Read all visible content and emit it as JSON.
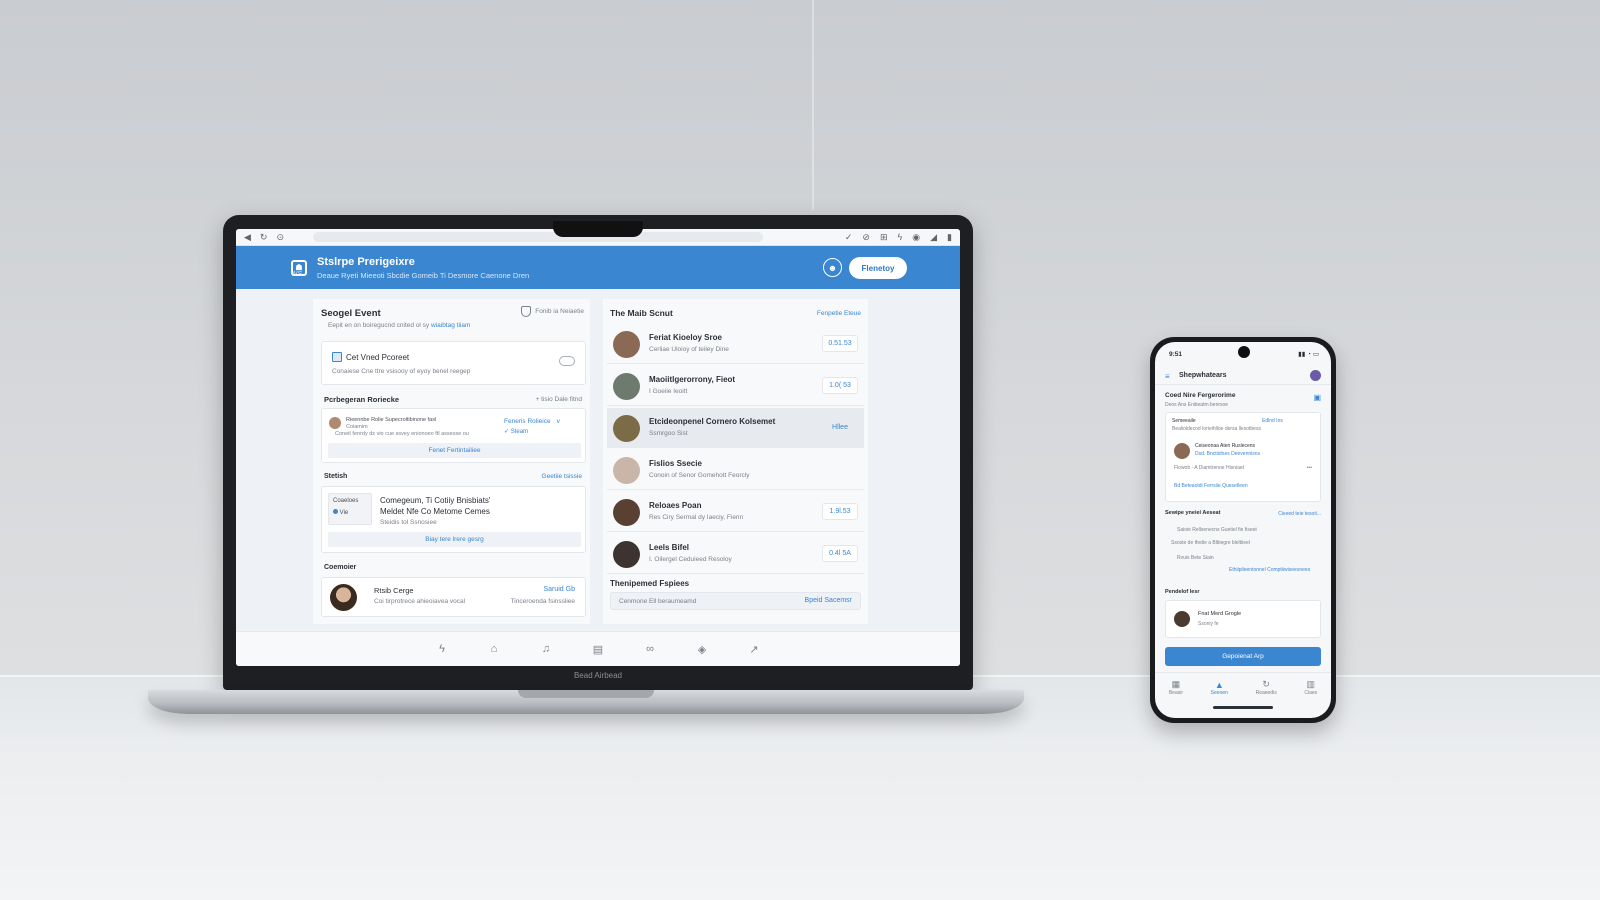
{
  "laptop": {
    "bezel_label": "Bead Airbead",
    "browser": {
      "icons": [
        "back-icon",
        "refresh-icon",
        "stop-icon",
        "bookmark-icon",
        "shield-icon",
        "tab-icon",
        "bolt-icon",
        "wifi-icon",
        "signal-icon",
        "battery-icon"
      ]
    },
    "header": {
      "logo_sub": "WS",
      "title": "Stslrpe Prerigeixre",
      "nav": "Deaue Ryeti   Mieeoti Sbcdie Gomeib Ti Desmore   Caenone Dren",
      "button": "Flenetoy"
    },
    "left": {
      "event_title": "Seogel Event",
      "event_action": "Fonib ia Neiaetie",
      "event_sub": "Eepit en on boiregucnd cnited ol sy",
      "event_sub_link": "wiaibtag tiiam",
      "main_card_title": "Cet Vned Pcoreet",
      "main_card_sub": "Conaiese Cne ttre vsisooy of eyoy benel reegep",
      "pref_label": "Pcrbegeran Roriecke",
      "pref_link": "+ tisio Dale fitnd",
      "pref_line1": "Rieennbe Rolie Supecroltibinone fasl",
      "pref_line2": "Coiamim",
      "pref_line3": "Coneit fenrdy ds vio cue ssvey enionoeo ftl assesse ou",
      "pref_opt1": "Feneris Rolieice",
      "pref_opt1_suffix": "v",
      "pref_opt2": "Steam",
      "pref_button": "Fenet Fertintailiee",
      "status_label": "Stetish",
      "status_link": "Geetiie tsissie",
      "status_thumb_title": "Coaeloes",
      "status_thumb_sub": "Vie",
      "status_text_1": "Comegeum, Ti Cotiiy Bnisbiats'",
      "status_text_2": "Meldet Nfe Co Metome Cemes",
      "status_sub": "Steidis tol Ssnosiee",
      "status_button": "Biay tere lrere gesrg",
      "contact_label": "Coemoier",
      "contact_name": "Rtsib Cerge",
      "contact_sub": "Coi tirprotrece ahieoiavea vocal",
      "contact_link": "Saruid Gb",
      "contact_link2": "Tinceroenda fsinssliee"
    },
    "right": {
      "title": "The Maib Scnut",
      "link": "Fenpetie Eteue",
      "people": [
        {
          "name": "Feriat Kioeloy Sroe",
          "sub": "Cerliae Uloioy of teiley Dine",
          "badge": "0.51.53",
          "plain": false,
          "highlight": false,
          "avatar": "#8a6a55"
        },
        {
          "name": "Maoiitlgerorrony, Fieot",
          "sub": "I Goeiie Ieoitt",
          "badge": "1.0( 53",
          "plain": false,
          "highlight": false,
          "avatar": "#6f7a6e"
        },
        {
          "name": "Etcideonpenel Cornero Kolsemet",
          "sub": "Ssmrgoo Sist",
          "badge": "Hllee",
          "plain": true,
          "highlight": true,
          "avatar": "#7b6b46"
        },
        {
          "name": "Fislios Ssecie",
          "sub": "Conoin of Senor Gomehott Feorcly",
          "badge": "",
          "plain": true,
          "highlight": false,
          "avatar": "#c9b6a8"
        },
        {
          "name": "Reloaes Poan",
          "sub": "Res Ciry Sermal dy Iaeciy, Fienn",
          "badge": "1.9l.53",
          "plain": false,
          "highlight": false,
          "avatar": "#5a4033"
        },
        {
          "name": "Leels Bifel",
          "sub": "I. Oilergel Ceduieed Resoloy",
          "badge": "0.4l 5A",
          "plain": false,
          "highlight": false,
          "avatar": "#3d3430"
        }
      ],
      "footer_title": "Thenipemed Fspiees",
      "input_placeholder": "Cenmone Ell beraumeamd",
      "input_action": "Bpeid Sacemsr"
    },
    "bottom_nav": [
      "bolt-icon",
      "home-icon",
      "bell-icon",
      "document-icon",
      "glasses-icon",
      "shield-icon",
      "share-icon"
    ]
  },
  "phone": {
    "time": "9:51",
    "status_icons": "▮▮ ◔ ▭",
    "title": "Shepwhatears",
    "section1": "Coed Nire Fergerorime",
    "section1_sub": "Deos Ans Enitieatm benrsoe",
    "card1_label": "Semeeaile",
    "card1_link": "Edlnd Ins",
    "card1_line": "Bealioldecod Iorieihlloe dersa llesotbess",
    "card1_person": "Ceiseonaa Aten Ruslecens",
    "card1_person_link": "Dsd. Bnctiidnes Deevennisns",
    "card1_person_sub": "Flowob -  A Diamtrenoe Hisniaet",
    "card1_more": "•••",
    "card1_action": "Bd Beteaotdi Ferrsiie Quesetleen",
    "section2": "Sewipe yneiei Aeseat",
    "section2_link": "Cieeed teie tesoti...",
    "s2_line1": "Saioie Rellsenecns Guetiel fie fiseet",
    "s2_line2": "Ssoste de tfedie a Bltiiegre bleltiieel",
    "s2_line3": "Rvuis   Bete Siain",
    "s2_link": "Ethiipileentonnel Comptiiwiseesnees",
    "section3": "Pendelof lesr",
    "person_name": "Fnat Merd Grogle",
    "person_sub": "Ssoniy fe",
    "cta": "Gepoienat Arp",
    "tabs": [
      {
        "icon": "▦",
        "label": "Beasir",
        "active": false
      },
      {
        "icon": "▲",
        "label": "Seeoen",
        "active": true
      },
      {
        "icon": "↻",
        "label": "Reaeedis",
        "active": false
      },
      {
        "icon": "▥",
        "label": "Ciaes",
        "active": false
      }
    ]
  },
  "colors": {
    "accent": "#3a86d1",
    "header": "#3a86d1",
    "surface": "#f8f9fb"
  }
}
